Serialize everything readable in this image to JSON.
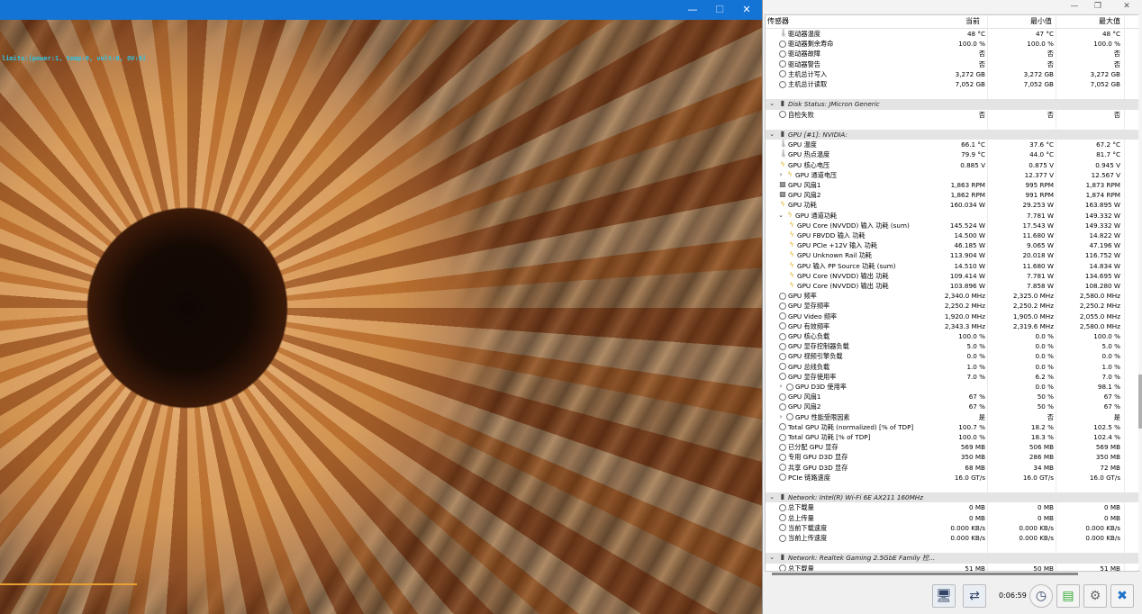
{
  "app": {
    "window_controls": {
      "minimize": "—",
      "maximize": "☐",
      "close": "✕"
    },
    "overlay_text": "limits:[power:1, temp:0, volt:0, OV:0]"
  },
  "hwinfo": {
    "window_controls": {
      "minimize": "—",
      "restore": "❐",
      "close": "✕"
    },
    "headers": {
      "sensor": "传感器",
      "current": "当前",
      "min": "最小值",
      "max": "最大值"
    },
    "rows": [
      {
        "type": "item",
        "indent": 1,
        "icon": "thermometer-icon",
        "name": "驱动器温度",
        "cur": "48 °C",
        "min": "47 °C",
        "max": "48 °C"
      },
      {
        "type": "item",
        "indent": 1,
        "icon": "circle-icon",
        "name": "驱动器剩余寿命",
        "cur": "100.0 %",
        "min": "100.0 %",
        "max": "100.0 %"
      },
      {
        "type": "item",
        "indent": 1,
        "icon": "circle-icon",
        "name": "驱动器故障",
        "cur": "否",
        "min": "否",
        "max": "否"
      },
      {
        "type": "item",
        "indent": 1,
        "icon": "circle-icon",
        "name": "驱动器警告",
        "cur": "否",
        "min": "否",
        "max": "否"
      },
      {
        "type": "item",
        "indent": 1,
        "icon": "circle-icon",
        "name": "主机总计写入",
        "cur": "3,272 GB",
        "min": "3,272 GB",
        "max": "3,272 GB"
      },
      {
        "type": "item",
        "indent": 1,
        "icon": "circle-icon",
        "name": "主机总计读取",
        "cur": "7,052 GB",
        "min": "7,052 GB",
        "max": "7,052 GB"
      },
      {
        "type": "blank"
      },
      {
        "type": "group",
        "name": "Disk Status: JMicron Generic"
      },
      {
        "type": "item",
        "indent": 1,
        "icon": "circle-icon",
        "name": "自检失败",
        "cur": "否",
        "min": "否",
        "max": "否"
      },
      {
        "type": "blank"
      },
      {
        "type": "group",
        "name": "GPU [#1]: NVIDIA:"
      },
      {
        "type": "item",
        "indent": 1,
        "icon": "thermometer-icon",
        "name": "GPU 温度",
        "cur": "66.1 °C",
        "min": "37.6 °C",
        "max": "67.2 °C"
      },
      {
        "type": "item",
        "indent": 1,
        "icon": "thermometer-icon",
        "name": "GPU 热点温度",
        "cur": "79.9 °C",
        "min": "44.0 °C",
        "max": "81.7 °C"
      },
      {
        "type": "item",
        "indent": 1,
        "icon": "bolt-icon",
        "name": "GPU 核心电压",
        "cur": "0.885 V",
        "min": "0.875 V",
        "max": "0.945 V"
      },
      {
        "type": "item",
        "indent": 2,
        "expand": "›",
        "icon": "bolt-icon",
        "name": "GPU 通道电压",
        "cur": "",
        "min": "12.377 V",
        "max": "12.567 V"
      },
      {
        "type": "item",
        "indent": 1,
        "icon": "fan-icon",
        "name": "GPU 风扇1",
        "cur": "1,863 RPM",
        "min": "995 RPM",
        "max": "1,873 RPM"
      },
      {
        "type": "item",
        "indent": 1,
        "icon": "fan-icon",
        "name": "GPU 风扇2",
        "cur": "1,862 RPM",
        "min": "991 RPM",
        "max": "1,874 RPM"
      },
      {
        "type": "item",
        "indent": 1,
        "icon": "bolt-icon",
        "name": "GPU 功耗",
        "cur": "160.034 W",
        "min": "29.253 W",
        "max": "163.895 W"
      },
      {
        "type": "item",
        "indent": 2,
        "expand": "⌄",
        "icon": "bolt-icon",
        "name": "GPU 通道功耗",
        "cur": "",
        "min": "7.781 W",
        "max": "149.332 W"
      },
      {
        "type": "item",
        "indent": 3,
        "icon": "bolt-icon",
        "name": "GPU Core (NVVDD) 输入 功耗 (sum)",
        "cur": "145.524 W",
        "min": "17.543 W",
        "max": "149.332 W"
      },
      {
        "type": "item",
        "indent": 3,
        "icon": "bolt-icon",
        "name": "GPU FBVDD 输入 功耗",
        "cur": "14.500 W",
        "min": "11.680 W",
        "max": "14.822 W"
      },
      {
        "type": "item",
        "indent": 3,
        "icon": "bolt-icon",
        "name": "GPU PCIe +12V 输入 功耗",
        "cur": "46.185 W",
        "min": "9.065 W",
        "max": "47.196 W"
      },
      {
        "type": "item",
        "indent": 3,
        "icon": "bolt-icon",
        "name": "GPU Unknown Rail 功耗",
        "cur": "113.904 W",
        "min": "20.018 W",
        "max": "116.752 W"
      },
      {
        "type": "item",
        "indent": 3,
        "icon": "bolt-icon",
        "name": "GPU 输入 PP Source 功耗 (sum)",
        "cur": "14.510 W",
        "min": "11.680 W",
        "max": "14.834 W"
      },
      {
        "type": "item",
        "indent": 3,
        "icon": "bolt-icon",
        "name": "GPU Core (NVVDD) 输出 功耗",
        "cur": "109.414 W",
        "min": "7.781 W",
        "max": "134.695 W"
      },
      {
        "type": "item",
        "indent": 3,
        "icon": "bolt-icon",
        "name": "GPU Core (NVVDD) 输出 功耗",
        "cur": "103.896 W",
        "min": "7.858 W",
        "max": "108.280 W"
      },
      {
        "type": "item",
        "indent": 1,
        "icon": "circle-icon",
        "name": "GPU 频率",
        "cur": "2,340.0 MHz",
        "min": "2,325.0 MHz",
        "max": "2,580.0 MHz"
      },
      {
        "type": "item",
        "indent": 1,
        "icon": "circle-icon",
        "name": "GPU 显存频率",
        "cur": "2,250.2 MHz",
        "min": "2,250.2 MHz",
        "max": "2,250.2 MHz"
      },
      {
        "type": "item",
        "indent": 1,
        "icon": "circle-icon",
        "name": "GPU Video 频率",
        "cur": "1,920.0 MHz",
        "min": "1,905.0 MHz",
        "max": "2,055.0 MHz"
      },
      {
        "type": "item",
        "indent": 1,
        "icon": "circle-icon",
        "name": "GPU 有效频率",
        "cur": "2,343.3 MHz",
        "min": "2,319.6 MHz",
        "max": "2,580.0 MHz"
      },
      {
        "type": "item",
        "indent": 1,
        "icon": "circle-icon",
        "name": "GPU 核心负载",
        "cur": "100.0 %",
        "min": "0.0 %",
        "max": "100.0 %"
      },
      {
        "type": "item",
        "indent": 1,
        "icon": "circle-icon",
        "name": "GPU 显存控制器负载",
        "cur": "5.0 %",
        "min": "0.0 %",
        "max": "5.0 %"
      },
      {
        "type": "item",
        "indent": 1,
        "icon": "circle-icon",
        "name": "GPU 视频引擎负载",
        "cur": "0.0 %",
        "min": "0.0 %",
        "max": "0.0 %"
      },
      {
        "type": "item",
        "indent": 1,
        "icon": "circle-icon",
        "name": "GPU 总线负载",
        "cur": "1.0 %",
        "min": "0.0 %",
        "max": "1.0 %"
      },
      {
        "type": "item",
        "indent": 1,
        "icon": "circle-icon",
        "name": "GPU 显存使用率",
        "cur": "7.0 %",
        "min": "6.2 %",
        "max": "7.0 %"
      },
      {
        "type": "item",
        "indent": 2,
        "expand": "›",
        "icon": "circle-icon",
        "name": "GPU D3D 使用率",
        "cur": "",
        "min": "0.0 %",
        "max": "98.1 %"
      },
      {
        "type": "item",
        "indent": 1,
        "icon": "circle-icon",
        "name": "GPU 风扇1",
        "cur": "67 %",
        "min": "50 %",
        "max": "67 %"
      },
      {
        "type": "item",
        "indent": 1,
        "icon": "circle-icon",
        "name": "GPU 风扇2",
        "cur": "67 %",
        "min": "50 %",
        "max": "67 %"
      },
      {
        "type": "item",
        "indent": 2,
        "expand": "›",
        "icon": "circle-icon",
        "name": "GPU 性能受限因素",
        "cur": "是",
        "min": "否",
        "max": "是"
      },
      {
        "type": "item",
        "indent": 1,
        "icon": "circle-icon",
        "name": "Total GPU 功耗 (normalized) [% of TDP]",
        "cur": "100.7 %",
        "min": "18.2 %",
        "max": "102.5 %"
      },
      {
        "type": "item",
        "indent": 1,
        "icon": "circle-icon",
        "name": "Total GPU 功耗 [% of TDP]",
        "cur": "100.0 %",
        "min": "18.3 %",
        "max": "102.4 %"
      },
      {
        "type": "item",
        "indent": 1,
        "icon": "circle-icon",
        "name": "已分配 GPU 显存",
        "cur": "569 MB",
        "min": "506 MB",
        "max": "569 MB"
      },
      {
        "type": "item",
        "indent": 1,
        "icon": "circle-icon",
        "name": "专用 GPU D3D 显存",
        "cur": "350 MB",
        "min": "286 MB",
        "max": "350 MB"
      },
      {
        "type": "item",
        "indent": 1,
        "icon": "circle-icon",
        "name": "共享 GPU D3D 显存",
        "cur": "68 MB",
        "min": "34 MB",
        "max": "72 MB"
      },
      {
        "type": "item",
        "indent": 1,
        "icon": "circle-icon",
        "name": "PCIe 链路速度",
        "cur": "16.0 GT/s",
        "min": "16.0 GT/s",
        "max": "16.0 GT/s"
      },
      {
        "type": "blank"
      },
      {
        "type": "group",
        "name": "Network: Intel(R) Wi-Fi 6E AX211 160MHz"
      },
      {
        "type": "item",
        "indent": 1,
        "icon": "circle-icon",
        "name": "总下载量",
        "cur": "0 MB",
        "min": "0 MB",
        "max": "0 MB"
      },
      {
        "type": "item",
        "indent": 1,
        "icon": "circle-icon",
        "name": "总上传量",
        "cur": "0 MB",
        "min": "0 MB",
        "max": "0 MB"
      },
      {
        "type": "item",
        "indent": 1,
        "icon": "circle-icon",
        "name": "当前下载速度",
        "cur": "0.000 KB/s",
        "min": "0.000 KB/s",
        "max": "0.000 KB/s"
      },
      {
        "type": "item",
        "indent": 1,
        "icon": "circle-icon",
        "name": "当前上传速度",
        "cur": "0.000 KB/s",
        "min": "0.000 KB/s",
        "max": "0.000 KB/s"
      },
      {
        "type": "blank"
      },
      {
        "type": "group",
        "name": "Network: Realtek Gaming 2.5GbE Family 控..."
      },
      {
        "type": "item",
        "indent": 1,
        "icon": "circle-icon",
        "name": "总下载量",
        "cur": "51 MB",
        "min": "50 MB",
        "max": "51 MB"
      }
    ],
    "timer": "0:06:59",
    "toolbar": {
      "btn1_icon": "monitor-network-icon",
      "btn2_icon": "network-arrows-icon",
      "btn3_icon": "clock-icon",
      "btn4_icon": "report-add-icon",
      "btn5_icon": "settings-gear-icon",
      "btn6_icon": "close-x-icon"
    }
  }
}
